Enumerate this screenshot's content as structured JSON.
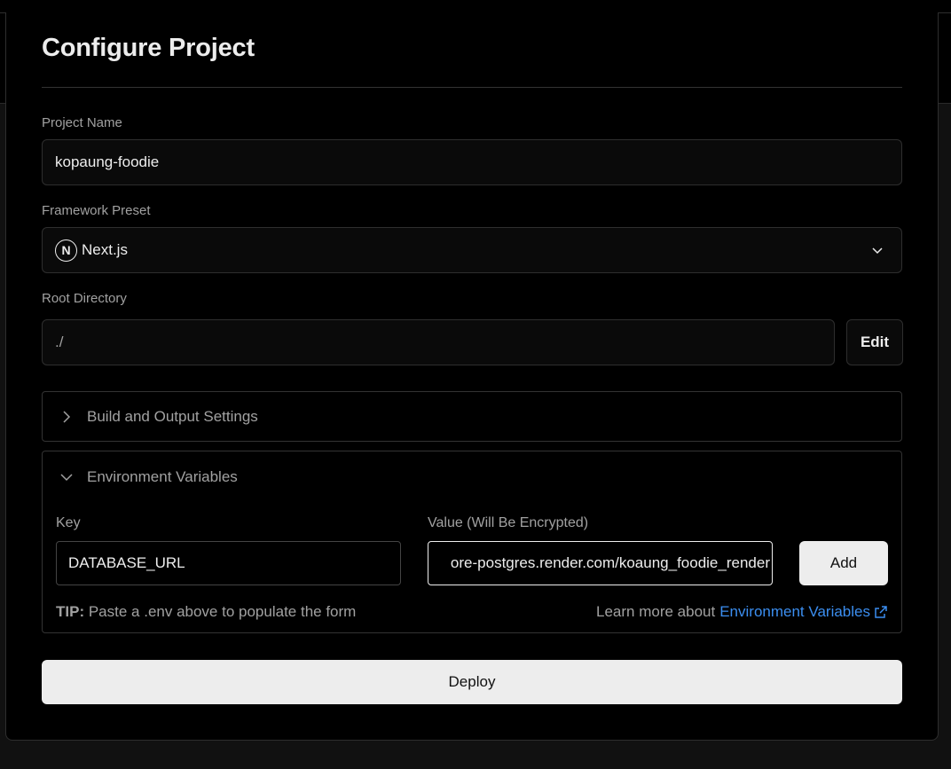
{
  "page": {
    "title": "Configure Project"
  },
  "project_name": {
    "label": "Project Name",
    "value": "kopaung-foodie"
  },
  "framework": {
    "label": "Framework Preset",
    "logo_letter": "N",
    "value": "Next.js"
  },
  "root_directory": {
    "label": "Root Directory",
    "value": "./",
    "edit_label": "Edit"
  },
  "build_settings": {
    "label": "Build and Output Settings"
  },
  "env": {
    "label": "Environment Variables",
    "key_label": "Key",
    "value_label": "Value (Will Be Encrypted)",
    "key_value": "DATABASE_URL",
    "value_value": "ore-postgres.render.com/koaung_foodie_render",
    "add_label": "Add",
    "tip_prefix": "TIP:",
    "tip_text": "Paste a .env above to populate the form",
    "learn_text": "Learn more about",
    "learn_link": "Environment Variables"
  },
  "deploy": {
    "label": "Deploy"
  },
  "colors": {
    "link": "#3b8ef0",
    "button_bg": "#ededed",
    "page_bg": "#000000"
  }
}
